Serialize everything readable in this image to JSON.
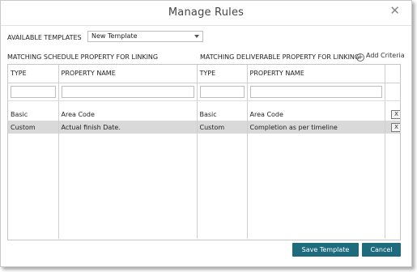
{
  "dialog": {
    "title": "Manage Rules",
    "close_icon": "close-icon"
  },
  "templates": {
    "label": "AVAILABLE TEMPLATES",
    "selected": "New Template"
  },
  "sections": {
    "schedule_label": "MATCHING SCHEDULE PROPERTY FOR LINKING",
    "deliverable_label": "MATCHING DELIVERABLE PROPERTY FOR LINKING",
    "add_criteria": "Add Criteria",
    "add_icon": "plus-circle-icon"
  },
  "table": {
    "headers": [
      "TYPE",
      "PROPERTY NAME",
      "TYPE",
      "PROPERTY NAME",
      ""
    ],
    "rows": [
      {
        "s_type": "Basic",
        "s_name": "Area Code",
        "d_type": "Basic",
        "d_name": "Area Code",
        "remove": "X"
      },
      {
        "s_type": "Custom",
        "s_name": "Actual finish Date.",
        "d_type": "Custom",
        "d_name": "Completion as per timeline",
        "remove": "X"
      }
    ]
  },
  "footer": {
    "save": "Save Template",
    "cancel": "Cancel"
  },
  "colors": {
    "primary_button": "#1e6b7e",
    "selected_row": "#d9d9d9"
  }
}
